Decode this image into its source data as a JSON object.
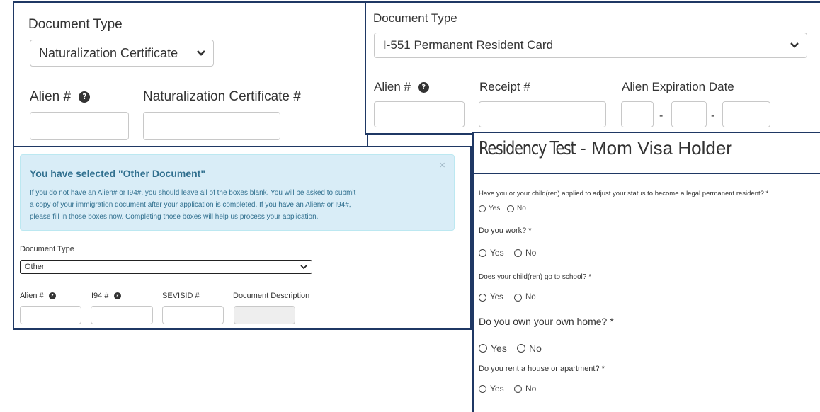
{
  "panel_a": {
    "doc_type_label": "Document Type",
    "doc_type_value": "Naturalization Certificate",
    "alien_label": "Alien #",
    "help_glyph": "?",
    "cert_label": "Naturalization Certificate #"
  },
  "panel_b": {
    "doc_type_label": "Document Type",
    "doc_type_value": "I-551 Permanent Resident Card",
    "alien_label": "Alien #",
    "help_glyph": "?",
    "receipt_label": "Receipt #",
    "expiry_label": "Alien Expiration Date",
    "date_sep": "-"
  },
  "panel_c": {
    "alert_title": "You have selected \"Other Document\"",
    "alert_line1": "If you do not have an Alien# or I94#, you should leave all of the boxes blank. You will be asked to submit",
    "alert_line2": "a copy of your immigration document after your application is completed. If you have an Alien# or I94#,",
    "alert_line3": "please fill in those boxes now. Completing those boxes will help us process your application.",
    "close_glyph": "×",
    "doc_type_label": "Document Type",
    "doc_type_value": "Other",
    "alien_label": "Alien #",
    "i94_label": "I94 #",
    "sevis_label": "SEVISID #",
    "desc_label": "Document Description",
    "help_glyph": "?"
  },
  "panel_d": {
    "title_part1": "Residency Test",
    "title_part2": "- Mom Visa Holder",
    "yes": "Yes",
    "no": "No",
    "questions": [
      "Have you or your child(ren) applied to adjust your status to become a legal permanent resident? *",
      "Do you work? *",
      "Does your child(ren) go to school? *",
      "Do you own your own home? *",
      "Do you rent a house or apartment? *"
    ]
  },
  "colors": {
    "panel_border": "#1f3864",
    "alert_bg": "#d9edf7",
    "alert_title": "#31708f",
    "alert_text": "#31708f"
  }
}
